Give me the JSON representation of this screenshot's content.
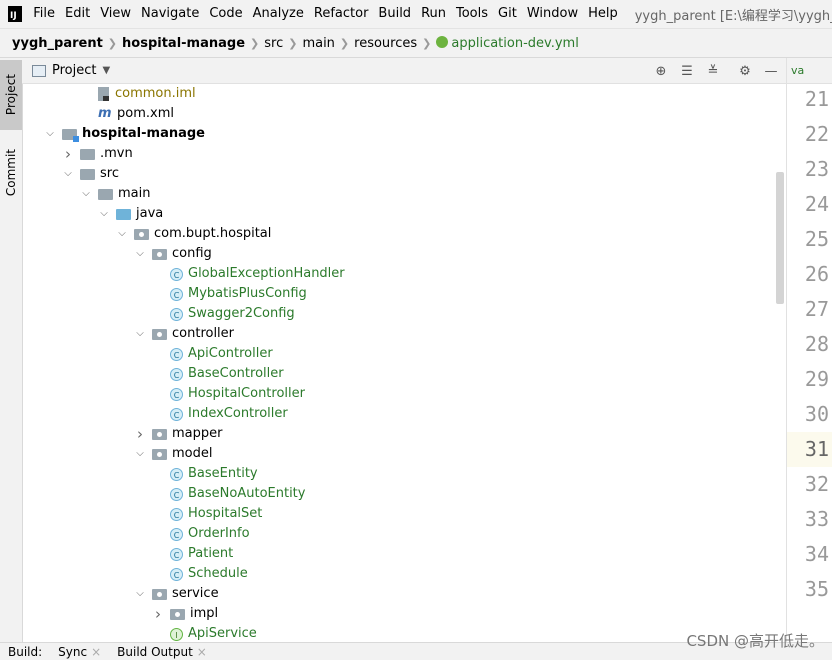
{
  "menubar": {
    "items": [
      "File",
      "Edit",
      "View",
      "Navigate",
      "Code",
      "Analyze",
      "Refactor",
      "Build",
      "Run",
      "Tools",
      "Git",
      "Window",
      "Help"
    ],
    "window_title": "yygh_parent [E:\\编程学习\\yygh_pare"
  },
  "breadcrumb": [
    "yygh_parent",
    "hospital-manage",
    "src",
    "main",
    "resources",
    "application-dev.yml"
  ],
  "left_strip": {
    "project_tab": "Project",
    "commit_tab": "Commit"
  },
  "project_panel": {
    "title": "Project"
  },
  "tree": [
    {
      "label": "common.iml",
      "depth": 3,
      "kind": "iml",
      "chev": "none",
      "color": "olive"
    },
    {
      "label": "pom.xml",
      "depth": 3,
      "kind": "pom",
      "chev": "none",
      "color": ""
    },
    {
      "label": "hospital-manage",
      "depth": 1,
      "kind": "module",
      "chev": "open",
      "color": "bold"
    },
    {
      "label": ".mvn",
      "depth": 2,
      "kind": "folder",
      "chev": "closed",
      "color": ""
    },
    {
      "label": "src",
      "depth": 2,
      "kind": "folder",
      "chev": "open",
      "color": ""
    },
    {
      "label": "main",
      "depth": 3,
      "kind": "folder",
      "chev": "open",
      "color": ""
    },
    {
      "label": "java",
      "depth": 4,
      "kind": "blue",
      "chev": "open",
      "color": ""
    },
    {
      "label": "com.bupt.hospital",
      "depth": 5,
      "kind": "pkg",
      "chev": "open",
      "color": ""
    },
    {
      "label": "config",
      "depth": 6,
      "kind": "pkg",
      "chev": "open",
      "color": ""
    },
    {
      "label": "GlobalExceptionHandler",
      "depth": 7,
      "kind": "class",
      "chev": "none",
      "color": "green"
    },
    {
      "label": "MybatisPlusConfig",
      "depth": 7,
      "kind": "class",
      "chev": "none",
      "color": "green"
    },
    {
      "label": "Swagger2Config",
      "depth": 7,
      "kind": "class",
      "chev": "none",
      "color": "green"
    },
    {
      "label": "controller",
      "depth": 6,
      "kind": "pkg",
      "chev": "open",
      "color": ""
    },
    {
      "label": "ApiController",
      "depth": 7,
      "kind": "class",
      "chev": "none",
      "color": "green"
    },
    {
      "label": "BaseController",
      "depth": 7,
      "kind": "class",
      "chev": "none",
      "color": "green"
    },
    {
      "label": "HospitalController",
      "depth": 7,
      "kind": "class",
      "chev": "none",
      "color": "green"
    },
    {
      "label": "IndexController",
      "depth": 7,
      "kind": "class",
      "chev": "none",
      "color": "green"
    },
    {
      "label": "mapper",
      "depth": 6,
      "kind": "pkg",
      "chev": "closed",
      "color": ""
    },
    {
      "label": "model",
      "depth": 6,
      "kind": "pkg",
      "chev": "open",
      "color": ""
    },
    {
      "label": "BaseEntity",
      "depth": 7,
      "kind": "class",
      "chev": "none",
      "color": "green"
    },
    {
      "label": "BaseNoAutoEntity",
      "depth": 7,
      "kind": "class",
      "chev": "none",
      "color": "green"
    },
    {
      "label": "HospitalSet",
      "depth": 7,
      "kind": "class",
      "chev": "none",
      "color": "green"
    },
    {
      "label": "OrderInfo",
      "depth": 7,
      "kind": "class",
      "chev": "none",
      "color": "green"
    },
    {
      "label": "Patient",
      "depth": 7,
      "kind": "class",
      "chev": "none",
      "color": "green"
    },
    {
      "label": "Schedule",
      "depth": 7,
      "kind": "class",
      "chev": "none",
      "color": "green"
    },
    {
      "label": "service",
      "depth": 6,
      "kind": "pkg",
      "chev": "open",
      "color": ""
    },
    {
      "label": "impl",
      "depth": 7,
      "kind": "pkg",
      "chev": "closed",
      "color": ""
    },
    {
      "label": "ApiService",
      "depth": 7,
      "kind": "iface",
      "chev": "none",
      "color": "green"
    }
  ],
  "gutter": {
    "tab": "va",
    "line_numbers": [
      "21",
      "22",
      "23",
      "24",
      "25",
      "26",
      "27",
      "28",
      "29",
      "30",
      "31",
      "32",
      "33",
      "34",
      "35"
    ],
    "current_line": "31"
  },
  "bottom_bar": {
    "tabs": [
      "Build:",
      "Sync",
      "Build Output"
    ]
  },
  "watermark": "CSDN @高开低走。",
  "colors": {
    "green": "#2b7a2b",
    "olive": "#8a7500",
    "accent": "#3d8ee0"
  }
}
